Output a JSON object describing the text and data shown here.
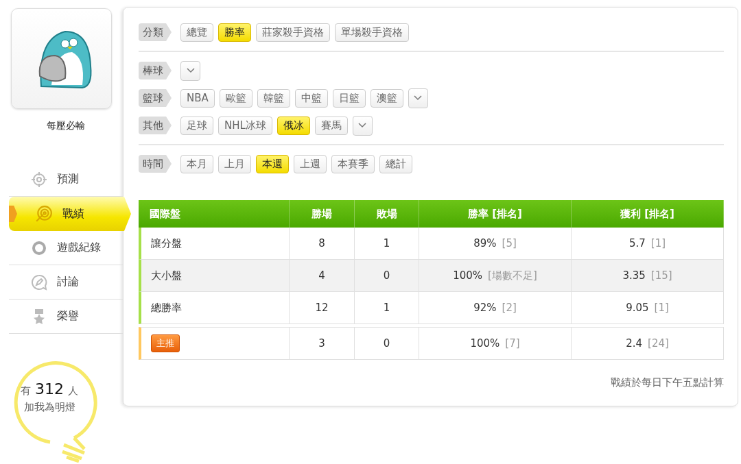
{
  "profile": {
    "name": "每壓必輸"
  },
  "nav": [
    {
      "label": "預測",
      "selected": false
    },
    {
      "label": "戰績",
      "selected": true
    },
    {
      "label": "遊戲紀錄",
      "selected": false
    },
    {
      "label": "討論",
      "selected": false
    },
    {
      "label": "榮譽",
      "selected": false
    }
  ],
  "fans": {
    "prefix": "有",
    "count": "312",
    "suffix": "人",
    "caption": "加我為明燈"
  },
  "filter_sections": [
    {
      "rows": [
        {
          "label": "分類",
          "options": [
            {
              "label": "總覽",
              "selected": false
            },
            {
              "label": "勝率",
              "selected": true
            },
            {
              "label": "莊家殺手資格",
              "selected": false
            },
            {
              "label": "單場殺手資格",
              "selected": false
            }
          ]
        }
      ]
    },
    {
      "rows": [
        {
          "label": "棒球",
          "options": [],
          "dropdown": true
        },
        {
          "label": "籃球",
          "options": [
            {
              "label": "NBA",
              "selected": false
            },
            {
              "label": "歐籃",
              "selected": false
            },
            {
              "label": "韓籃",
              "selected": false
            },
            {
              "label": "中籃",
              "selected": false
            },
            {
              "label": "日籃",
              "selected": false
            },
            {
              "label": "澳籃",
              "selected": false
            }
          ],
          "dropdown": true
        },
        {
          "label": "其他",
          "options": [
            {
              "label": "足球",
              "selected": false
            },
            {
              "label": "NHL冰球",
              "selected": false
            },
            {
              "label": "俄冰",
              "selected": true
            },
            {
              "label": "賽馬",
              "selected": false
            }
          ],
          "dropdown": true
        }
      ]
    },
    {
      "rows": [
        {
          "label": "時間",
          "options": [
            {
              "label": "本月",
              "selected": false
            },
            {
              "label": "上月",
              "selected": false
            },
            {
              "label": "本週",
              "selected": true
            },
            {
              "label": "上週",
              "selected": false
            },
            {
              "label": "本賽季",
              "selected": false
            },
            {
              "label": "總計",
              "selected": false
            }
          ]
        }
      ]
    }
  ],
  "table": {
    "columns": [
      "國際盤",
      "勝場",
      "敗場",
      "勝率 [排名]",
      "獲利 [排名]"
    ],
    "rows": [
      {
        "kind": "normal",
        "label": "讓分盤",
        "wins": "8",
        "losses": "1",
        "rate": "89%",
        "rate_rank": "[5]",
        "profit": "5.7",
        "profit_rank": "[1]"
      },
      {
        "kind": "normal",
        "label": "大小盤",
        "wins": "4",
        "losses": "0",
        "rate": "100%",
        "rate_rank": "[場數不足]",
        "profit": "3.35",
        "profit_rank": "[15]"
      },
      {
        "kind": "normal",
        "label": "總勝率",
        "wins": "12",
        "losses": "1",
        "rate": "92%",
        "rate_rank": "[2]",
        "profit": "9.05",
        "profit_rank": "[1]"
      },
      {
        "kind": "featured",
        "label": "主推",
        "wins": "3",
        "losses": "0",
        "rate": "100%",
        "rate_rank": "[7]",
        "profit": "2.4",
        "profit_rank": "[24]"
      }
    ]
  },
  "note": "戰績於每日下午五點計算"
}
